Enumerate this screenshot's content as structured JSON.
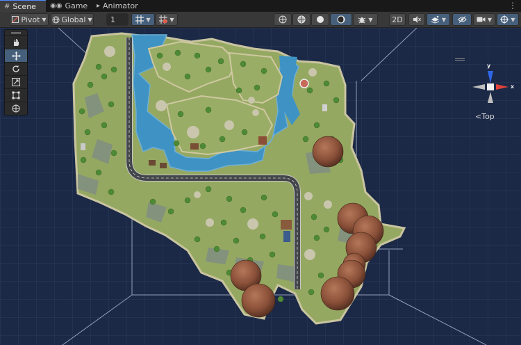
{
  "tabs": [
    {
      "label": "Scene",
      "icon": "scene-grid-icon",
      "active": true
    },
    {
      "label": "Game",
      "icon": "gamepad-icon",
      "active": false
    },
    {
      "label": "Animator",
      "icon": "animator-icon",
      "active": false
    }
  ],
  "menu_icon": "kebab-menu-icon",
  "toolbar": {
    "pivot_label": "Pivot",
    "global_label": "Global",
    "grid_size_value": "1",
    "twod_label": "2D"
  },
  "scene_gizmo": {
    "axis_y": "y",
    "axis_x": "x",
    "view_label": "Top"
  },
  "colors": {
    "accent": "#46607c",
    "gizmo_y": "#2e66e8",
    "gizmo_x": "#e0413a",
    "grass": "#95a861",
    "water": "#3f93c4",
    "road": "#424549",
    "rock": "#8a5038"
  }
}
